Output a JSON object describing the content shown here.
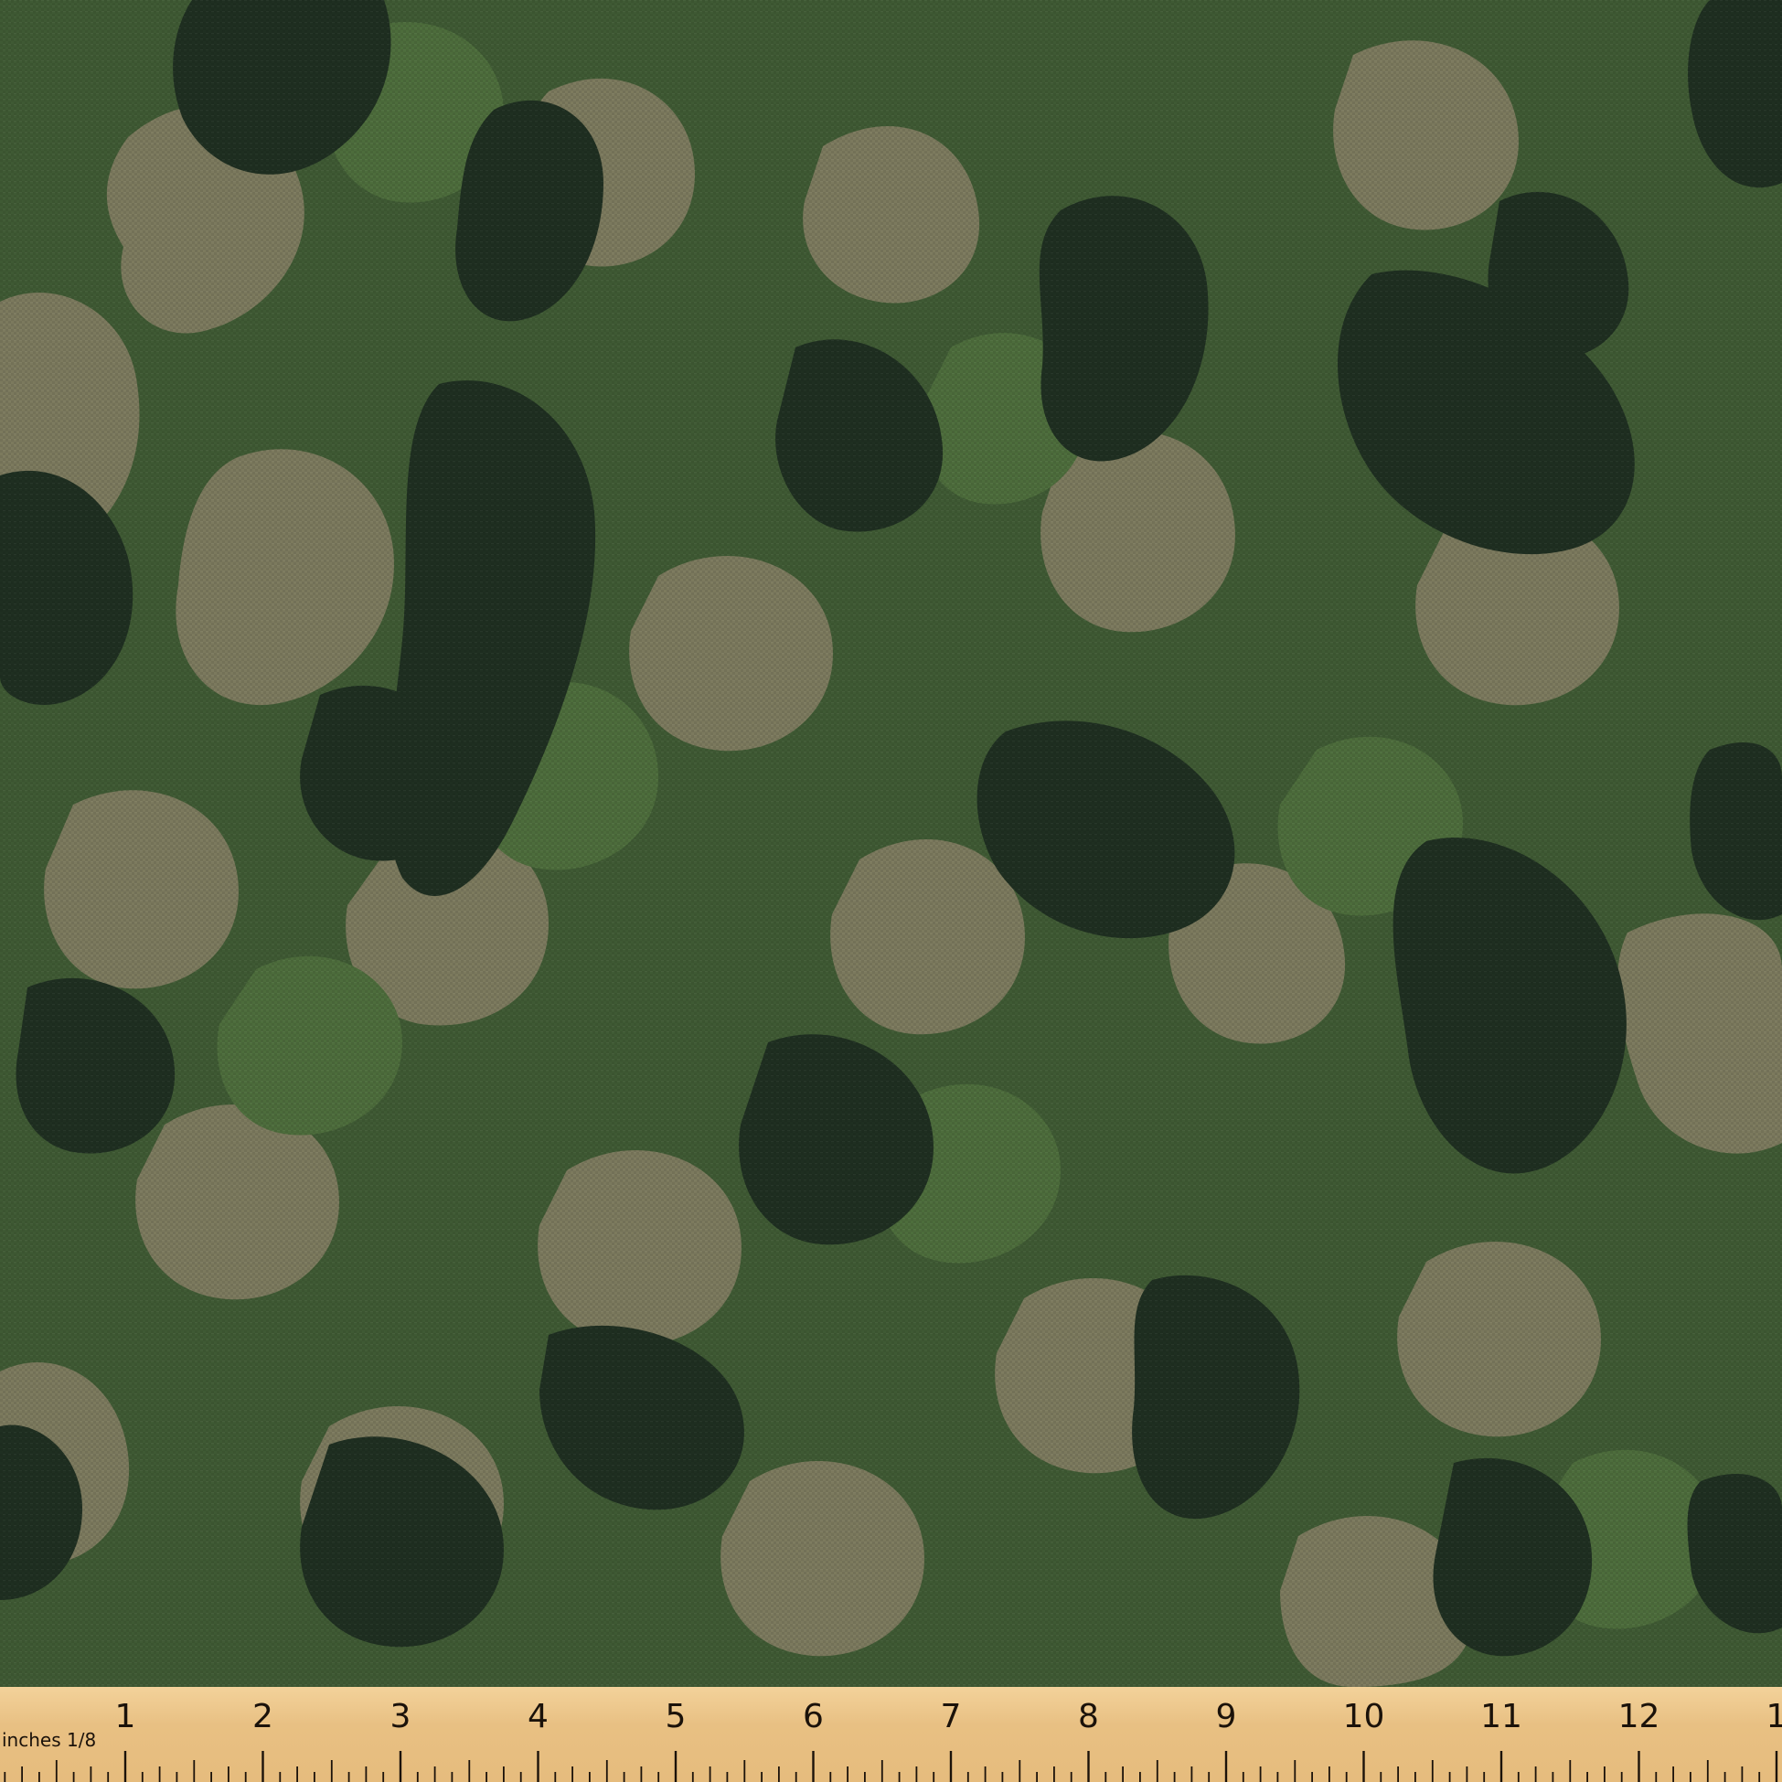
{
  "scene": {
    "subject": "camouflage-fabric",
    "colors": {
      "base_green": "#3f5a34",
      "mid_green": "#4b6a3b",
      "dark_green": "#1f2f21",
      "tan": "#7c7a5e",
      "ruler_wood": "#e8c083",
      "ruler_ink": "#1b120a"
    }
  },
  "ruler": {
    "unit_label": "inches 1/8",
    "numbers": [
      "1",
      "2",
      "3",
      "4",
      "5",
      "6",
      "7",
      "8",
      "9",
      "10",
      "11",
      "12",
      "1"
    ]
  }
}
